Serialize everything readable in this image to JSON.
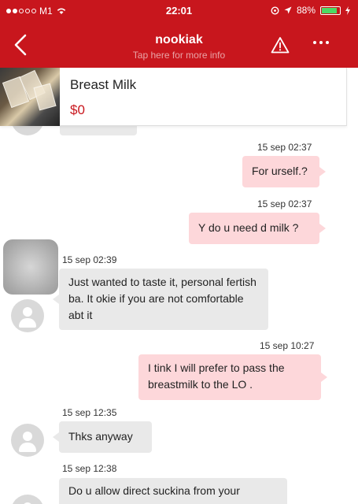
{
  "status_bar": {
    "carrier": "M1",
    "time": "22:01",
    "battery": "88%"
  },
  "nav": {
    "title": "nookiak",
    "subtitle": "Tap here for more info",
    "back_icon": "chevron-left-icon",
    "warning_icon": "warning-icon",
    "more_icon": "more-dots-icon"
  },
  "product": {
    "name": "Breast Milk",
    "price": "$0"
  },
  "messages": [
    {
      "direction": "out",
      "timestamp": "15 sep 02:37",
      "text": "For urself.?"
    },
    {
      "direction": "out",
      "timestamp": "15 sep 02:37",
      "text": "Y do u need d milk ?"
    },
    {
      "direction": "in",
      "timestamp": "15 sep 02:39",
      "text": "Just wanted to taste it, personal fertish ba. It okie if you are not comfortable abt it"
    },
    {
      "direction": "out",
      "timestamp": "15 sep 10:27",
      "text": "I tink I will prefer to pass the breastmilk to the LO ."
    },
    {
      "direction": "in",
      "timestamp": "15 sep 12:35",
      "text": "Thks anyway"
    },
    {
      "direction": "in",
      "timestamp": "15 sep 12:38",
      "text": "Do u allow direct suckina from your"
    }
  ],
  "colors": {
    "header": "#c8161d",
    "outgoing_bubble": "#fdd7da",
    "incoming_bubble": "#e9e9e9",
    "price": "#c8161d"
  }
}
